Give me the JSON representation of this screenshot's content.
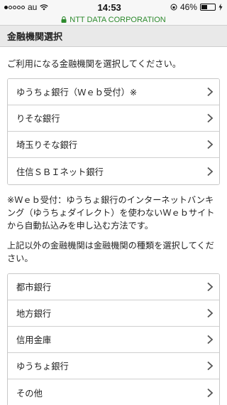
{
  "status_bar": {
    "carrier": "au",
    "time": "14:53",
    "battery": "46%",
    "battery_level": 0.46
  },
  "url_bar": {
    "site": "NTT DATA CORPORATION"
  },
  "page": {
    "title": "金融機関選択",
    "intro": "ご利用になる金融機関を選択してください。"
  },
  "primary_banks": [
    {
      "label": "ゆうちょ銀行（Ｗｅｂ受付）※"
    },
    {
      "label": "りそな銀行"
    },
    {
      "label": "埼玉りそな銀行"
    },
    {
      "label": "住信ＳＢＩネット銀行"
    }
  ],
  "note": "※Ｗｅｂ受付：ゆうちょ銀行のインターネットバンキング（ゆうちょダイレクト）を使わないＷｅｂサイトから自動払込みを申し込む方法です。",
  "other_intro": "上記以外の金融機関は金融機関の種類を選択してください。",
  "bank_types": [
    {
      "label": "都市銀行"
    },
    {
      "label": "地方銀行"
    },
    {
      "label": "信用金庫"
    },
    {
      "label": "ゆうちょ銀行"
    },
    {
      "label": "その他"
    }
  ]
}
